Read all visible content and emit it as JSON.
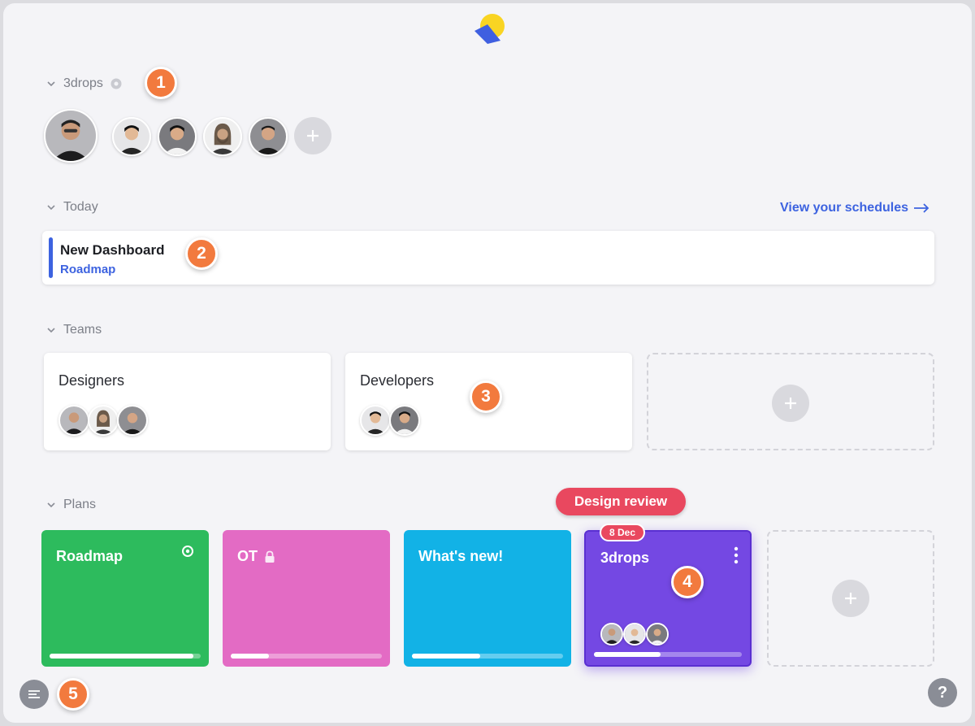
{
  "workspace": {
    "name": "3drops",
    "settings_icon": "gear-icon"
  },
  "badges": [
    "1",
    "2",
    "3",
    "4",
    "5"
  ],
  "today": {
    "heading": "Today",
    "view_link": "View your schedules",
    "item_title": "New Dashboard",
    "item_subtitle": "Roadmap",
    "accent": "#3d63e0"
  },
  "teams": {
    "heading": "Teams",
    "items": [
      {
        "name": "Designers",
        "member_count": 3
      },
      {
        "name": "Developers",
        "member_count": 2
      }
    ]
  },
  "plans": {
    "heading": "Plans",
    "event_label": "Design review",
    "event_date": "8 Dec",
    "items": [
      {
        "name": "Roadmap",
        "color": "#2dbb5d",
        "progress": 0.95,
        "icon": "target-icon"
      },
      {
        "name": "OT",
        "color": "#e36bc4",
        "progress": 0.25,
        "icon": "lock-icon"
      },
      {
        "name": "What's new!",
        "color": "#12b2e6",
        "progress": 0.45
      },
      {
        "name": "3drops",
        "color": "#7448e3",
        "progress": 0.45,
        "icon": "more-vertical-icon"
      }
    ]
  },
  "colors": {
    "badge": "#f27a3e",
    "event": "#e9485f",
    "link": "#3d63e0"
  }
}
